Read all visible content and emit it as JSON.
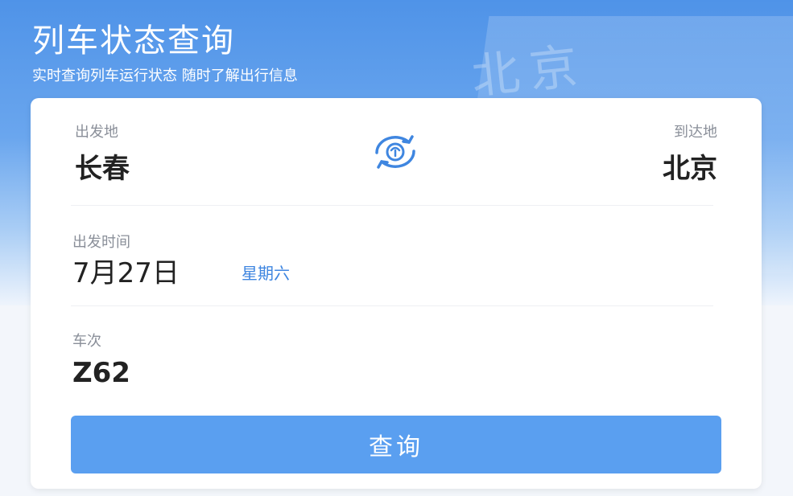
{
  "header": {
    "title": "列车状态查询",
    "subtitle": "实时查询列车运行状态 随时了解出行信息",
    "bg_station_text": "北京"
  },
  "form": {
    "from_label": "出发地",
    "from_city": "长春",
    "to_label": "到达地",
    "to_city": "北京",
    "swap_icon": "train-swap-icon",
    "time_label": "出发时间",
    "date": "7月27日",
    "weekday": "星期六",
    "train_label": "车次",
    "train_no": "Z62",
    "query_label": "查询"
  },
  "colors": {
    "accent": "#5a9ff0",
    "weekday": "#3f86e0",
    "header_bg": "#4f93e8"
  }
}
